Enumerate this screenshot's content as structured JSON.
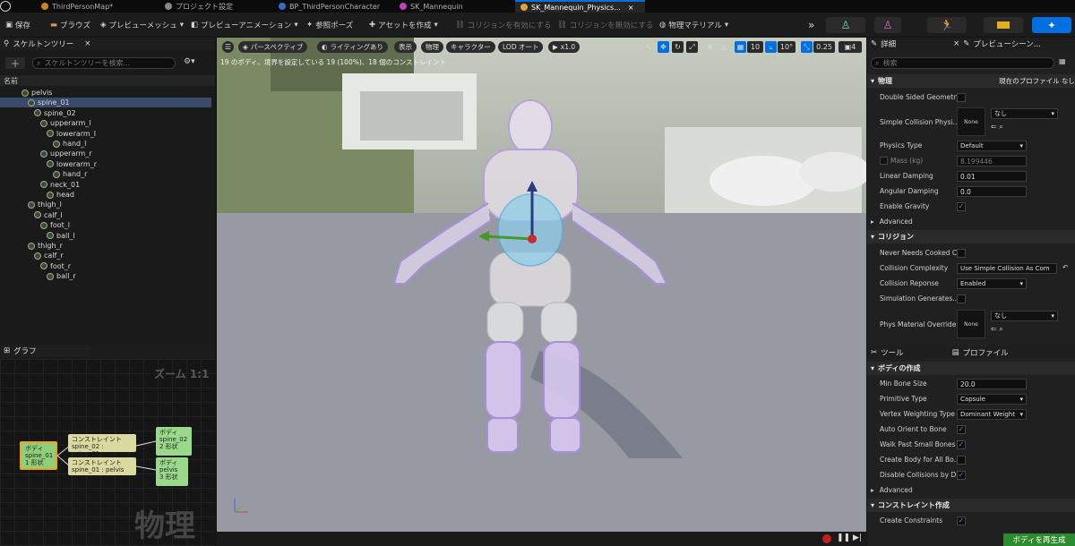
{
  "tabs": [
    {
      "label": "ThirdPersonMap*",
      "active": false
    },
    {
      "label": "プロジェクト設定",
      "active": false
    },
    {
      "label": "BP_ThirdPersonCharacter",
      "active": false
    },
    {
      "label": "SK_Mannequin",
      "active": false
    },
    {
      "label": "SK_Mannequin_Physics...",
      "active": true
    }
  ],
  "toolbar": {
    "save": "保存",
    "browse": "ブラウズ",
    "preview_mesh": "プレビューメッシュ",
    "preview_anim": "プレビューアニメーション",
    "ref_pose": "参照ポーズ",
    "create_asset": "アセットを作成",
    "enable_collision": "コリジョンを有効にする",
    "disable_collision": "コリジョンを無効にする",
    "phys_material": "物理マテリアル"
  },
  "skeleton_tree": {
    "title": "スケルトンツリー",
    "search_placeholder": "スケルトンツリーを検索...",
    "name_header": "名前",
    "bones": [
      {
        "name": "pelvis",
        "depth": 0,
        "selected": false
      },
      {
        "name": "spine_01",
        "depth": 1,
        "selected": true
      },
      {
        "name": "spine_02",
        "depth": 2,
        "selected": false
      },
      {
        "name": "upperarm_l",
        "depth": 3,
        "selected": false
      },
      {
        "name": "lowerarm_l",
        "depth": 4,
        "selected": false
      },
      {
        "name": "hand_l",
        "depth": 5,
        "selected": false
      },
      {
        "name": "upperarm_r",
        "depth": 3,
        "selected": false
      },
      {
        "name": "lowerarm_r",
        "depth": 4,
        "selected": false
      },
      {
        "name": "hand_r",
        "depth": 5,
        "selected": false
      },
      {
        "name": "neck_01",
        "depth": 3,
        "selected": false
      },
      {
        "name": "head",
        "depth": 4,
        "selected": false
      },
      {
        "name": "thigh_l",
        "depth": 1,
        "selected": false
      },
      {
        "name": "calf_l",
        "depth": 2,
        "selected": false
      },
      {
        "name": "foot_l",
        "depth": 3,
        "selected": false
      },
      {
        "name": "ball_l",
        "depth": 4,
        "selected": false
      },
      {
        "name": "thigh_r",
        "depth": 1,
        "selected": false
      },
      {
        "name": "calf_r",
        "depth": 2,
        "selected": false
      },
      {
        "name": "foot_r",
        "depth": 3,
        "selected": false
      },
      {
        "name": "ball_r",
        "depth": 4,
        "selected": false
      }
    ]
  },
  "graph": {
    "title": "グラフ",
    "zoom": "ズーム 1:1",
    "watermark": "物理",
    "body_spine01": [
      "ボディ",
      "spine_01",
      "1 形状"
    ],
    "constraint1": [
      "コンストレイント",
      "spine_02 : spine_01"
    ],
    "constraint2": [
      "コンストレイント",
      "spine_01 : pelvis"
    ],
    "body_spine02": [
      "ボディ",
      "spine_02",
      "2 形状"
    ],
    "body_pelvis": [
      "ボディ",
      "pelvis",
      "3 形状"
    ]
  },
  "viewport": {
    "perspective": "パースペクティブ",
    "lighting": "ライティングあり",
    "show": "表示",
    "physics": "物理",
    "character": "キャラクター",
    "lod": "LOD オート",
    "speed": "x1.0",
    "info": "19 のボディ、境界を設定している 19 (100%)、18 個のコンストレイント",
    "grid": "10",
    "angle": "10°",
    "scale": "0.25",
    "cams": "4"
  },
  "details": {
    "tab1": "詳細",
    "tab2": "プレビューシーン...",
    "search_placeholder": "検索",
    "physics_section": "物理",
    "current_profile": "現在のプロファイル なし",
    "double_sided": "Double Sided Geometry",
    "simple_collision": "Simple Collision Physi...",
    "none_thumb": "None",
    "none_value": "なし",
    "physics_type": "Physics Type",
    "physics_type_val": "Default",
    "mass": "Mass (kg)",
    "mass_val": "8.199446",
    "linear_damping": "Linear Damping",
    "linear_damping_val": "0.01",
    "angular_damping": "Angular Damping",
    "angular_damping_val": "0.0",
    "enable_gravity": "Enable Gravity",
    "advanced": "Advanced",
    "collision_section": "コリジョン",
    "never_needs": "Never Needs Cooked C...",
    "collision_complexity": "Collision Complexity",
    "collision_complexity_val": "Use Simple Collision As Com",
    "collision_response": "Collision Reponse",
    "collision_response_val": "Enabled",
    "sim_generates": "Simulation Generates...",
    "phys_mat_override": "Phys Material Override"
  },
  "tools": {
    "tab1": "ツール",
    "tab2": "プロファイル",
    "body_section": "ボディの作成",
    "min_bone": "Min Bone Size",
    "min_bone_val": "20.0",
    "primitive": "Primitive Type",
    "primitive_val": "Capsule",
    "vertex_weighting": "Vertex Weighting Type",
    "vertex_weighting_val": "Dominant Weight",
    "auto_orient": "Auto Orient to Bone",
    "walk_past": "Walk Past Small Bones",
    "create_all": "Create Body for All Bo...",
    "disable_coll": "Disable Collisions by D...",
    "advanced": "Advanced",
    "constraint_section": "コンストレイント作成",
    "create_constraints": "Create Constraints",
    "regen_button": "ボディを再生成"
  }
}
